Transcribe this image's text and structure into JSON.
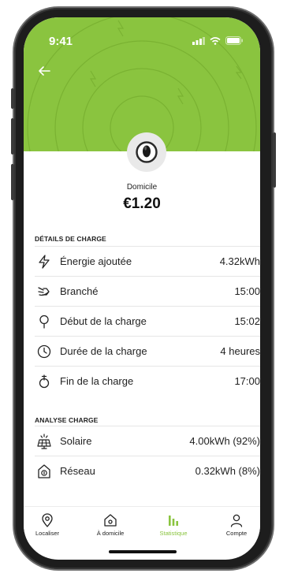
{
  "status": {
    "time": "9:41"
  },
  "header": {
    "back_label": "←"
  },
  "charger": {
    "name": "Domicile",
    "price": "€1.20"
  },
  "details": {
    "title": "DÉTAILS DE CHARGE",
    "rows": [
      {
        "label": "Énergie ajoutée",
        "value": "4.32kWh",
        "icon": "lightning-icon"
      },
      {
        "label": "Branché",
        "value": "15:00",
        "icon": "plug-icon"
      },
      {
        "label": "Début de la charge",
        "value": "15:02",
        "icon": "location-pin-icon"
      },
      {
        "label": "Durée de la charge",
        "value": "4 heures",
        "icon": "clock-icon"
      },
      {
        "label": "Fin de la charge",
        "value": "17:00",
        "icon": "charge-end-icon"
      }
    ]
  },
  "analysis": {
    "title": "ANALYSE CHARGE",
    "rows": [
      {
        "label": "Solaire",
        "value": "4.00kWh (92%)",
        "icon": "solar-panel-icon"
      },
      {
        "label": "Réseau",
        "value": "0.32kWh (8%)",
        "icon": "grid-home-icon"
      }
    ]
  },
  "tabs": [
    {
      "label": "Localiser",
      "icon": "location-icon"
    },
    {
      "label": "À domicile",
      "icon": "home-icon"
    },
    {
      "label": "Statistique",
      "icon": "bar-chart-icon",
      "active": true
    },
    {
      "label": "Compte",
      "icon": "user-icon"
    }
  ],
  "colors": {
    "accent": "#8ac43f",
    "text": "#222222"
  }
}
